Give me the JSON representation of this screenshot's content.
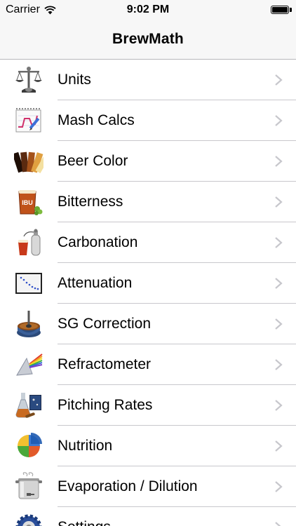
{
  "status_bar": {
    "carrier": "Carrier",
    "time": "9:02 PM",
    "battery_level": 1.0
  },
  "nav": {
    "title": "BrewMath"
  },
  "menu": {
    "items": [
      {
        "label": "Units",
        "icon": "balance-scale-icon"
      },
      {
        "label": "Mash Calcs",
        "icon": "chart-notepad-icon"
      },
      {
        "label": "Beer Color",
        "icon": "color-swatches-icon"
      },
      {
        "label": "Bitterness",
        "icon": "ibu-beer-glass-icon"
      },
      {
        "label": "Carbonation",
        "icon": "co2-tank-icon"
      },
      {
        "label": "Attenuation",
        "icon": "decline-graph-icon"
      },
      {
        "label": "SG Correction",
        "icon": "hydrometer-icon"
      },
      {
        "label": "Refractometer",
        "icon": "prism-icon"
      },
      {
        "label": "Pitching Rates",
        "icon": "yeast-flask-icon"
      },
      {
        "label": "Nutrition",
        "icon": "pie-chart-icon"
      },
      {
        "label": "Evaporation / Dilution",
        "icon": "brew-kettle-icon"
      },
      {
        "label": "Settings",
        "icon": "settings-gear-icon"
      }
    ]
  },
  "colors": {
    "bar_background": "#f7f7f7",
    "separator": "#c8c7cc",
    "chevron": "#c7c7cc"
  }
}
